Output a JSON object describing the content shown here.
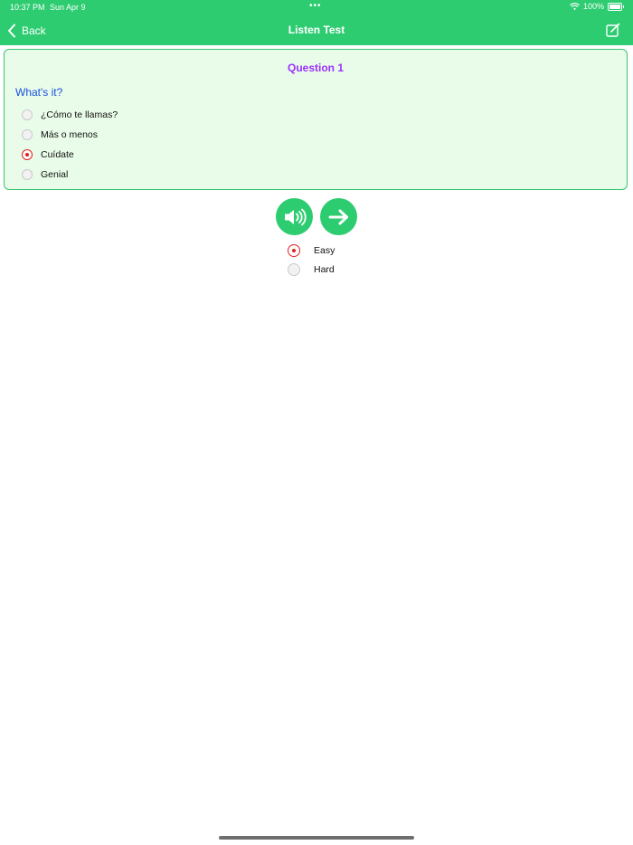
{
  "status_bar": {
    "time": "10:37 PM",
    "date": "Sun Apr 9",
    "battery": "100%",
    "dots": "•••",
    "icons": [
      "wifi-icon",
      "battery-icon"
    ]
  },
  "nav": {
    "back_label": "Back",
    "title": "Listen Test",
    "back_icon": "chevron-left-icon",
    "edit_icon": "edit-icon"
  },
  "question": {
    "title": "Question 1",
    "prompt": "What's it?",
    "options": [
      {
        "label": "¿Cómo te llamas?",
        "selected": false
      },
      {
        "label": "Más o menos",
        "selected": false
      },
      {
        "label": "Cuídate",
        "selected": true
      },
      {
        "label": "Genial",
        "selected": false
      }
    ]
  },
  "controls": {
    "speaker_icon": "speaker-icon",
    "next_icon": "arrow-right-icon"
  },
  "difficulty": {
    "options": [
      {
        "label": "Easy",
        "selected": true
      },
      {
        "label": "Hard",
        "selected": false
      }
    ]
  },
  "colors": {
    "accent": "#2ecc71",
    "card_bg": "#e9fce9",
    "question_title": "#9b30ff",
    "prompt": "#1a4fe0",
    "radio_selected": "#e02020"
  }
}
